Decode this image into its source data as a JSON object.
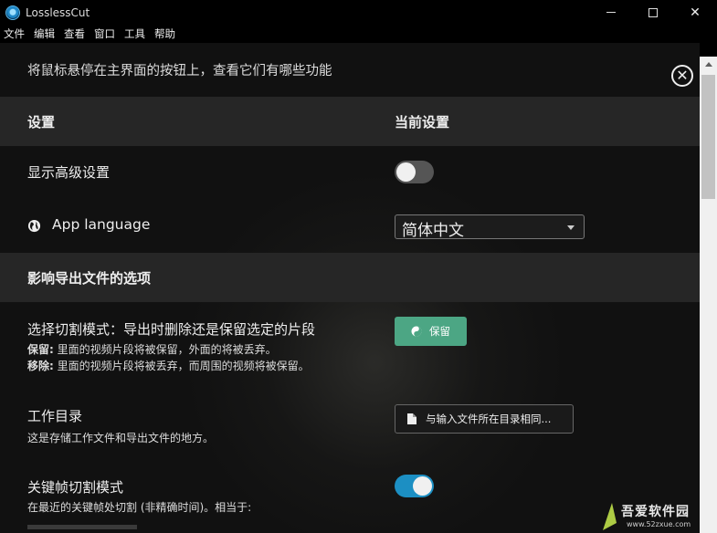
{
  "window": {
    "title": "LosslessCut"
  },
  "menu": [
    "文件",
    "编辑",
    "查看",
    "窗口",
    "工具",
    "帮助"
  ],
  "hint": "将鼠标悬停在主界面的按钮上，查看它们有哪些功能",
  "header1": {
    "col1": "设置",
    "col2": "当前设置"
  },
  "advanced": {
    "label": "显示高级设置",
    "enabled": false
  },
  "language": {
    "label": "App language",
    "value": "简体中文"
  },
  "header2": {
    "title": "影响导出文件的选项"
  },
  "cut_mode": {
    "label": "选择切割模式：导出时删除还是保留选定的片段",
    "keep_prefix": "保留:",
    "keep_desc": " 里面的视频片段将被保留，外面的将被丢弃。",
    "remove_prefix": "移除:",
    "remove_desc": " 里面的视频片段将被丢弃，而周围的视频将被保留。",
    "button": "保留"
  },
  "workdir": {
    "label": "工作目录",
    "desc": "这是存储工作文件和导出文件的地方。",
    "button": "与输入文件所在目录相同..."
  },
  "keyframe": {
    "label": "关键帧切割模式",
    "desc": "在最近的关键帧处切割 (非精确时间)。相当于:",
    "enabled": true
  },
  "watermark": {
    "text": "吾爱软件园",
    "url": "www.52zxue.com"
  },
  "colors": {
    "accent": "#1c8fc3",
    "keep_button": "#4ca684",
    "header_bg": "#262626"
  }
}
